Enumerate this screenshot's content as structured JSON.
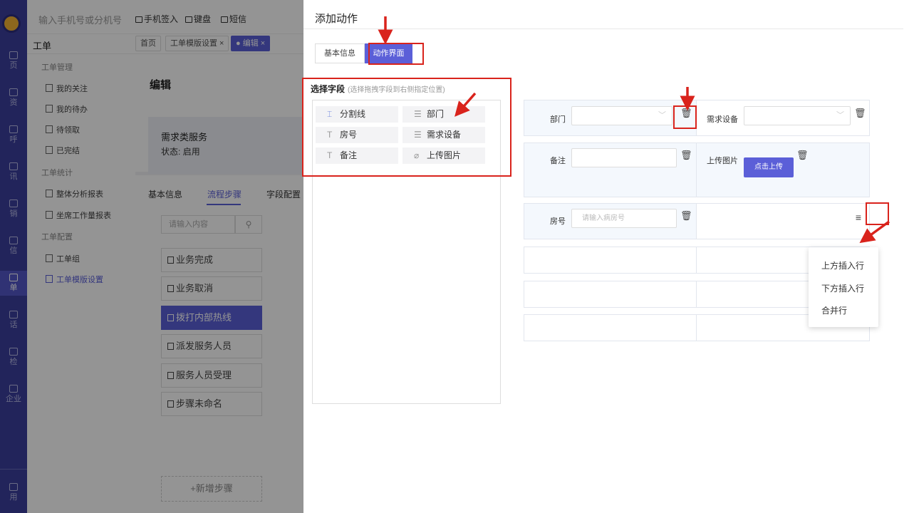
{
  "topbar": {
    "phone_placeholder": "输入手机号或分机号",
    "tools": [
      "手机签入",
      "键盘",
      "短信"
    ]
  },
  "rail": {
    "items": [
      "页",
      "资",
      "呼",
      "讯",
      "销",
      "信",
      "单",
      "话",
      "检",
      "企业",
      "用"
    ]
  },
  "section": {
    "title": "工单",
    "tabs": [
      "首页",
      "工单模版设置 ×",
      "● 编辑 ×"
    ]
  },
  "sidemenu": {
    "groups": [
      {
        "label": "工单管理",
        "items": [
          "我的关注",
          "我的待办",
          "待领取",
          "已完结"
        ]
      },
      {
        "label": "工单统计",
        "items": [
          "整体分析报表",
          "坐席工作量报表"
        ]
      },
      {
        "label": "工单配置",
        "items": [
          "工单组",
          "工单模版设置"
        ]
      }
    ]
  },
  "main": {
    "title": "编辑",
    "service_name": "需求类服务",
    "status_label": "状态:",
    "status_value": "启用",
    "tabs": [
      "基本信息",
      "流程步骤",
      "字段配置"
    ],
    "search_placeholder": "请输入内容",
    "steps": [
      "业务完成",
      "业务取消",
      "拨打内部热线",
      "派发服务人员",
      "服务人员受理",
      "步骤未命名"
    ],
    "add_step": "+新增步骤"
  },
  "drawer": {
    "title": "添加动作",
    "tab_basic": "基本信息",
    "tab_action": "动作界面",
    "select_title": "选择字段",
    "select_hint": "(选择拖拽字段到右侧指定位置)",
    "fields": [
      {
        "label": "分割线",
        "icon": "divider-icon"
      },
      {
        "label": "部门",
        "icon": "select-icon"
      },
      {
        "label": "房号",
        "icon": "text-icon"
      },
      {
        "label": "需求设备",
        "icon": "select-icon"
      },
      {
        "label": "备注",
        "icon": "text-icon"
      },
      {
        "label": "上传图片",
        "icon": "paperclip-icon"
      }
    ],
    "form": {
      "dept_label": "部门",
      "device_label": "需求设备",
      "remark_label": "备注",
      "upload_label": "上传图片",
      "upload_button": "点击上传",
      "room_label": "房号",
      "room_placeholder": "请输入病房号"
    },
    "context_menu": [
      "上方插入行",
      "下方插入行",
      "合并行"
    ]
  }
}
